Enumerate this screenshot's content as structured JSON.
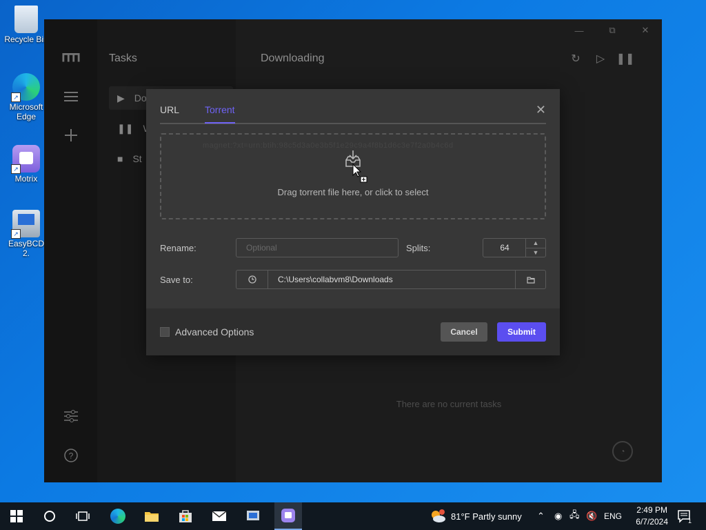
{
  "desktop": {
    "icons": [
      {
        "label": "Recycle Bin",
        "icon": "recycle-bin-icon"
      },
      {
        "label": "Microsoft Edge",
        "icon": "edge-icon"
      },
      {
        "label": "Motrix",
        "icon": "motrix-icon"
      },
      {
        "label": "EasyBCD 2.",
        "icon": "easybcd-icon"
      }
    ]
  },
  "app": {
    "logo": "m",
    "sidebar": {
      "title": "Tasks",
      "items": [
        {
          "label": "Do",
          "icon": "play-icon"
        },
        {
          "label": "W",
          "icon": "pause-icon"
        },
        {
          "label": "St",
          "icon": "stop-icon"
        }
      ]
    },
    "main": {
      "title": "Downloading",
      "empty_text": "There are no current tasks"
    }
  },
  "dialog": {
    "tabs": [
      "URL",
      "Torrent"
    ],
    "active_tab": "Torrent",
    "drop_text": "Drag torrent file here, or click to select",
    "ghost_text": "magnet:?xt=urn:btih:98c5d3a0e3b5f1e29c9a4f8b1d6c3e7f2a0b4c6d",
    "rename_label": "Rename:",
    "rename_placeholder": "Optional",
    "splits_label": "Splits:",
    "splits_value": "64",
    "saveto_label": "Save to:",
    "save_path": "C:\\Users\\collabvm8\\Downloads",
    "advanced_label": "Advanced Options",
    "cancel_label": "Cancel",
    "submit_label": "Submit",
    "accent_color": "#5b4ef0"
  },
  "taskbar": {
    "weather": "81°F  Partly sunny",
    "lang": "ENG",
    "time": "2:49 PM",
    "date": "6/7/2024",
    "notification_count": "1"
  }
}
